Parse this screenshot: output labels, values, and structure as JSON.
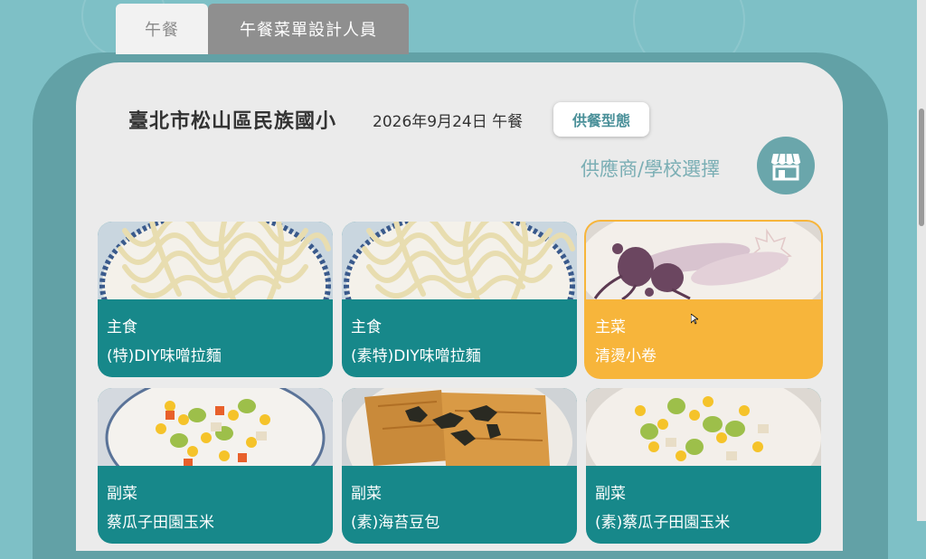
{
  "tabs": [
    {
      "label": "午餐",
      "active": true
    },
    {
      "label": "午餐菜單設計人員",
      "active": false
    }
  ],
  "header": {
    "school_name": "臺北市松山區民族國小",
    "date_meal": "2026年9月24日 午餐",
    "meal_type_button": "供餐型態",
    "supplier_label": "供應商/學校選擇",
    "store_icon": "store-icon"
  },
  "colors": {
    "background": "#7ec0c6",
    "card_teal": "#17888a",
    "card_highlight": "#f7b53b",
    "accent_text": "#4a9099"
  },
  "dishes": [
    {
      "category": "主食",
      "name": "(特)DIY味噌拉麵",
      "image": "noodles",
      "highlighted": false
    },
    {
      "category": "主食",
      "name": "(素特)DIY味噌拉麵",
      "image": "noodles",
      "highlighted": false
    },
    {
      "category": "主菜",
      "name": "清燙小卷",
      "image": "squid",
      "highlighted": true
    },
    {
      "category": "副菜",
      "name": "蔡瓜子田園玉米",
      "image": "corn-mix",
      "highlighted": false
    },
    {
      "category": "副菜",
      "name": "(素)海苔豆包",
      "image": "tofu-skin",
      "highlighted": false
    },
    {
      "category": "副菜",
      "name": "(素)蔡瓜子田園玉米",
      "image": "corn-mix",
      "highlighted": false
    }
  ]
}
